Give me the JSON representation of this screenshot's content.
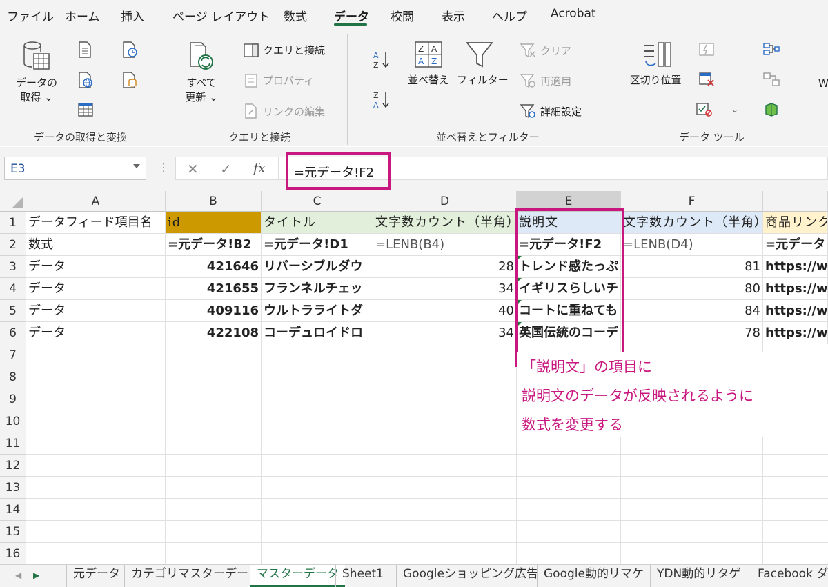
{
  "ribbon_tabs": [
    "ファイル",
    "ホーム",
    "挿入",
    "ページ レイアウト",
    "数式",
    "データ",
    "校閲",
    "表示",
    "ヘルプ",
    "Acrobat"
  ],
  "active_tab": "データ",
  "accent_color": "#217346",
  "highlight_color": "#c8177f",
  "groups": {
    "get_data": {
      "label": "データの取得と変換",
      "get_data_button": [
        "データの",
        "取得 ⌄"
      ]
    },
    "queries": {
      "label": "クエリと接続",
      "refresh_all": [
        "すべて",
        "更新 ⌄"
      ],
      "queries_connections": "クエリと接続",
      "properties": "プロパティ",
      "edit_links": "リンクの編集"
    },
    "sort_filter": {
      "label": "並べ替えとフィルター",
      "sort": "並べ替え",
      "filter": "フィルター",
      "clear": "クリア",
      "reapply": "再適用",
      "advanced": "詳細設定"
    },
    "data_tools": {
      "label": "データ ツール",
      "text_to_columns": "区切り位置"
    },
    "partial_w": "W"
  },
  "formula_bar": {
    "name_box": "E3",
    "cancel_symbol": "✕",
    "enter_symbol": "✓",
    "fx_symbol": "fx",
    "formula": "=元データ!F2"
  },
  "columns": [
    "A",
    "B",
    "C",
    "D",
    "E",
    "F"
  ],
  "rows": [
    {
      "num": "1",
      "A": "データフィード項目名",
      "B": "id",
      "C": "タイトル",
      "D": "文字数カウント（半角）",
      "E": "説明文",
      "F": "文字数カウント（半角）",
      "G": "商品リンク"
    },
    {
      "num": "2",
      "A": "数式",
      "B": "=元データ!B2",
      "C": "=元データ!D1",
      "D": "=LENB(B4)",
      "E": "=元データ!F2",
      "F": "=LENB(D4)",
      "G": "=元データ"
    },
    {
      "num": "3",
      "A": "データ",
      "B": "421646",
      "C": "リバーシブルダウ",
      "D": "28",
      "E": "トレンド感たっぷ",
      "F": "81",
      "G": "https://w"
    },
    {
      "num": "4",
      "A": "データ",
      "B": "421655",
      "C": "フランネルチェッ",
      "D": "34",
      "E": "イギリスらしいチ",
      "F": "80",
      "G": "https://w"
    },
    {
      "num": "5",
      "A": "データ",
      "B": "409116",
      "C": "ウルトラライトダ",
      "D": "40",
      "E": "コートに重ねても",
      "F": "84",
      "G": "https://w"
    },
    {
      "num": "6",
      "A": "データ",
      "B": "422108",
      "C": "コーデュロイドロ",
      "D": "34",
      "E": "英国伝統のコーデ",
      "F": "78",
      "G": "https://w"
    }
  ],
  "empty_rows": [
    "7",
    "8",
    "9",
    "10",
    "11",
    "12",
    "13",
    "14",
    "15",
    "16"
  ],
  "header_colors": {
    "B": "#cc9900",
    "C": "#e2efda",
    "D": "#e2efda",
    "E": "#dde9f7",
    "F": "#dde9f7",
    "G": "#fff2cc"
  },
  "annotation": {
    "lines": [
      "「説明文」の項目に",
      "説明文のデータが反映されるように",
      "数式を変更する"
    ]
  },
  "sheet_tabs": [
    "元データ",
    "カテゴリマスターデータ",
    "マスターデータ",
    "Sheet1",
    "Googleショッピング広告",
    "Google動的リマケ",
    "YDN動的リタゲ",
    "Facebook ダ"
  ],
  "active_sheet": "マスターデータ"
}
